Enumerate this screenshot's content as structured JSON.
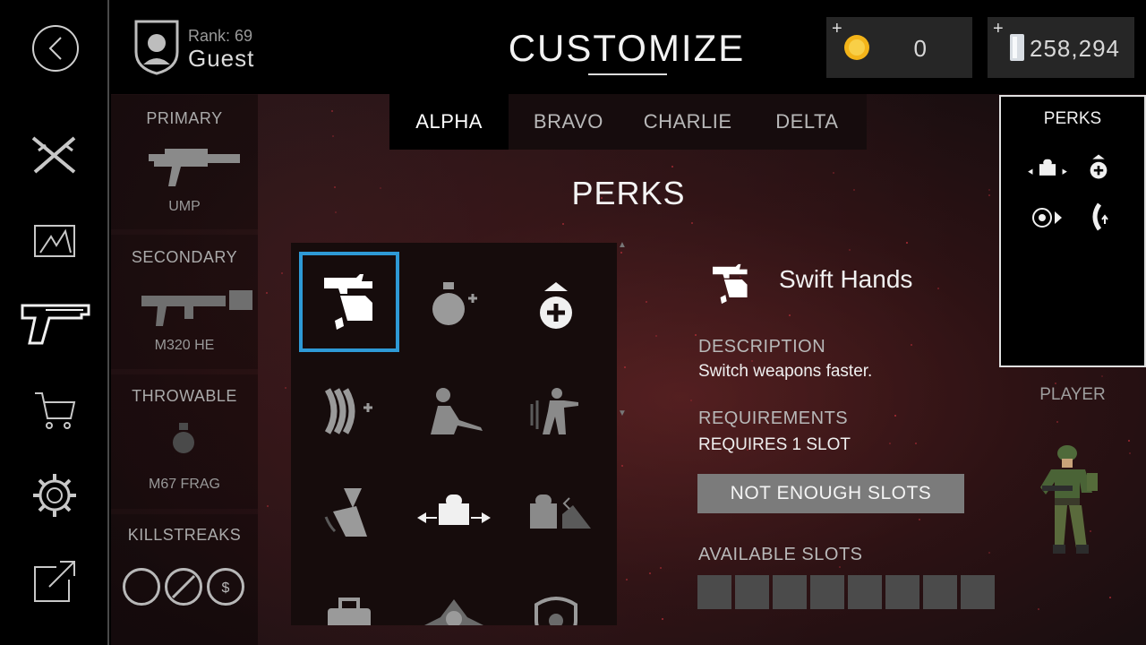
{
  "nav": {
    "items": [
      "back-icon",
      "loadouts-icon",
      "killstreaks-icon",
      "weapons-icon",
      "store-icon",
      "settings-icon",
      "external-link-icon"
    ]
  },
  "player": {
    "rank_label": "Rank: 69",
    "name": "Guest"
  },
  "header": {
    "title": "CUSTOMIZE"
  },
  "currency": {
    "gold": {
      "plus": "+",
      "value": "0",
      "icon": "gold-coin-icon"
    },
    "silver": {
      "plus": "+",
      "value": "258,294",
      "icon": "silver-bar-icon"
    }
  },
  "loadout": {
    "primary": {
      "header": "PRIMARY",
      "name": "UMP"
    },
    "secondary": {
      "header": "SECONDARY",
      "name": "M320 HE"
    },
    "throwable": {
      "header": "THROWABLE",
      "name": "M67 FRAG"
    },
    "killstreaks": {
      "header": "KILLSTREAKS"
    }
  },
  "tabs": [
    {
      "label": "ALPHA",
      "active": true
    },
    {
      "label": "BRAVO",
      "active": false
    },
    {
      "label": "CHARLIE",
      "active": false
    },
    {
      "label": "DELTA",
      "active": false
    }
  ],
  "section_title": "PERKS",
  "perk_grid": [
    "swift-hands-icon",
    "extra-grenade-icon",
    "health-boost-icon",
    "extra-ammo-icon",
    "sniper-camo-icon",
    "fast-move-icon",
    "quick-reload-icon",
    "wide-radar-icon",
    "turret-cover-icon",
    "toolbox-icon",
    "blast-icon",
    "shield-icon"
  ],
  "detail": {
    "name": "Swift Hands",
    "description_label": "DESCRIPTION",
    "description": "Switch weapons faster.",
    "requirements_label": "REQUIREMENTS",
    "requirements": "REQUIRES 1 SLOT",
    "button": "NOT ENOUGH SLOTS",
    "slots_label": "AVAILABLE SLOTS",
    "slot_count": 8
  },
  "perks_panel": {
    "header": "PERKS"
  },
  "player_panel": {
    "header": "PLAYER"
  },
  "colors": {
    "selection": "#2e9ad6",
    "accent_red": "#c0303a"
  }
}
